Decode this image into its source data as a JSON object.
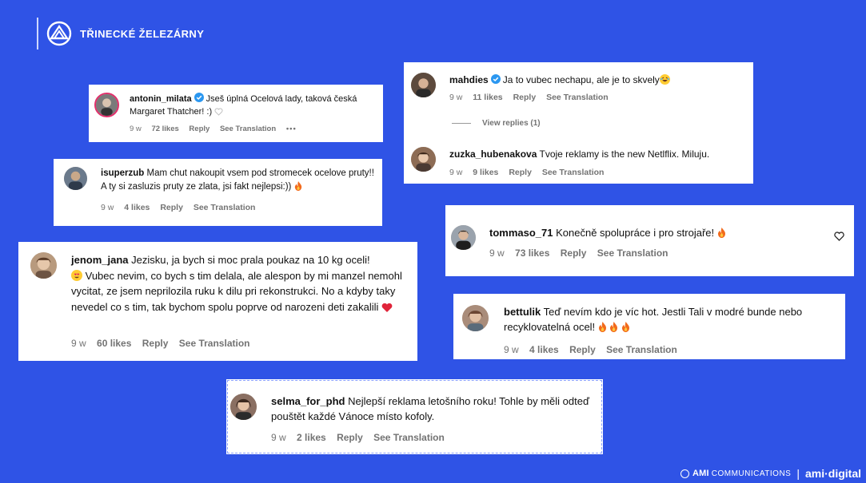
{
  "brand": {
    "name": "TŘINECKÉ ŽELEZÁRNY"
  },
  "colors": {
    "background": "#2f53e6",
    "meta_text": "#737373",
    "verified_blue": "#2b97f0"
  },
  "comments": [
    {
      "username": "antonin_milata",
      "verified": true,
      "text": "Jseš úplná Ocelová lady, taková česká Margaret Thatcher! :)",
      "age": "9 w",
      "likes": "72 likes",
      "reply": "Reply",
      "translation": "See Translation",
      "more": "•••"
    },
    {
      "username": "isuperzub",
      "text": "Mam chut nakoupit vsem pod stromecek ocelove pruty!! A ty si zasluzis pruty ze zlata, jsi fakt nejlepsi:))",
      "age": "9 w",
      "likes": "4 likes",
      "reply": "Reply",
      "translation": "See Translation"
    },
    {
      "username": "jenom_jana",
      "text": "Jezisku, ja bych si moc prala poukaz na 10 kg oceli!",
      "text2": "Vubec nevim, co bych s tim delala, ale alespon by mi manzel nemohl vycitat, ze jsem neprilozila ruku k dilu pri rekonstrukci. No a kdyby taky nevedel co s tim, tak bychom spolu poprve od narozeni deti zakalili",
      "age": "9 w",
      "likes": "60 likes",
      "reply": "Reply",
      "translation": "See Translation"
    },
    {
      "username": "mahdies",
      "verified": true,
      "text": "Ja to vubec nechapu, ale je to skvely",
      "age": "9 w",
      "likes": "11 likes",
      "reply": "Reply",
      "translation": "See Translation",
      "view_replies": "View replies (1)"
    },
    {
      "username": "zuzka_hubenakova",
      "text": "Tvoje reklamy is the new Netlflix. Miluju.",
      "age": "9 w",
      "likes": "9 likes",
      "reply": "Reply",
      "translation": "See Translation"
    },
    {
      "username": "tommaso_71",
      "text": "Konečně spolupráce i pro strojaře!",
      "age": "9 w",
      "likes": "73 likes",
      "reply": "Reply",
      "translation": "See Translation"
    },
    {
      "username": "bettulik",
      "text": "Teď nevím kdo je víc hot. Jestli Tali v modré bunde nebo recyklovatelná ocel!",
      "age": "9 w",
      "likes": "4 likes",
      "reply": "Reply",
      "translation": "See Translation"
    },
    {
      "username": "selma_for_phd",
      "text": "Nejlepší reklama letošního roku! Tohle by měli odteď pouštět každé Vánoce místo kofoly.",
      "age": "9 w",
      "likes": "2 likes",
      "reply": "Reply",
      "translation": "See Translation"
    }
  ],
  "footer": {
    "ami": "AMI",
    "communications": "COMMUNICATIONS",
    "separator": "|",
    "digital": "ami·digital"
  }
}
